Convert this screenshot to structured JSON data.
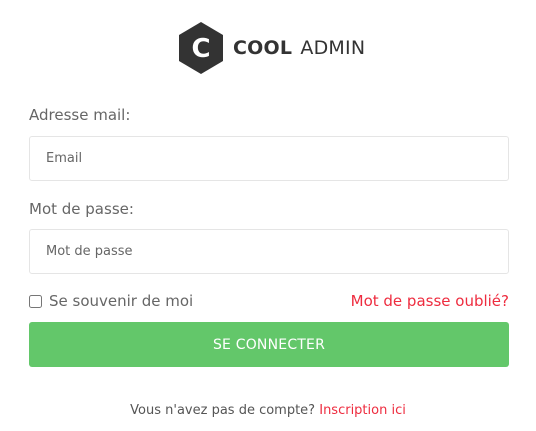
{
  "logo": {
    "icon_letter": "C",
    "brand_bold": "COOL",
    "brand_light": "ADMIN",
    "icon_color": "#333333"
  },
  "form": {
    "email_label": "Adresse mail:",
    "email_placeholder": "Email",
    "password_label": "Mot de passe:",
    "password_placeholder": "Mot de passe",
    "remember_label": "Se souvenir de moi",
    "remember_checked": false,
    "forgot_link": "Mot de passe oublié?",
    "submit_label": "SE CONNECTER"
  },
  "footer": {
    "prompt": "Vous n'avez pas de compte?",
    "signup_link": "Inscription ici"
  },
  "colors": {
    "accent_green": "#63c76a",
    "link_red": "#ee2c3f",
    "text_gray": "#666666"
  }
}
